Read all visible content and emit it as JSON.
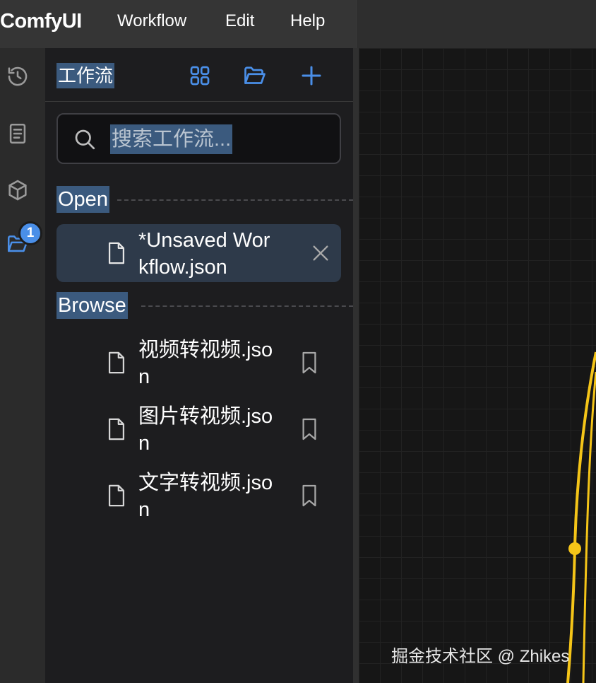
{
  "menubar": {
    "logo": "ComfyUI",
    "items": [
      {
        "label": "Workflow"
      },
      {
        "label": "Edit"
      },
      {
        "label": "Help"
      }
    ]
  },
  "rail": {
    "items": [
      {
        "icon": "history-icon"
      },
      {
        "icon": "book-icon"
      },
      {
        "icon": "cube-icon"
      },
      {
        "icon": "folder-open-icon",
        "active": true
      }
    ],
    "badge": "1"
  },
  "sidebar": {
    "title": "工作流",
    "search": {
      "placeholder": "搜索工作流..."
    },
    "open_label": "Open",
    "open_items": [
      {
        "name": "*Unsaved Workflow.json"
      }
    ],
    "browse_label": "Browse",
    "browse_items": [
      {
        "name": "视频转视频.json"
      },
      {
        "name": "图片转视频.json"
      },
      {
        "name": "文字转视频.json"
      }
    ]
  },
  "watermark": "掘金技术社区 @ Zhikes",
  "colors": {
    "accent": "#4a8fe8",
    "selection": "#3b5a7e",
    "link_wire": "#f5c518"
  }
}
